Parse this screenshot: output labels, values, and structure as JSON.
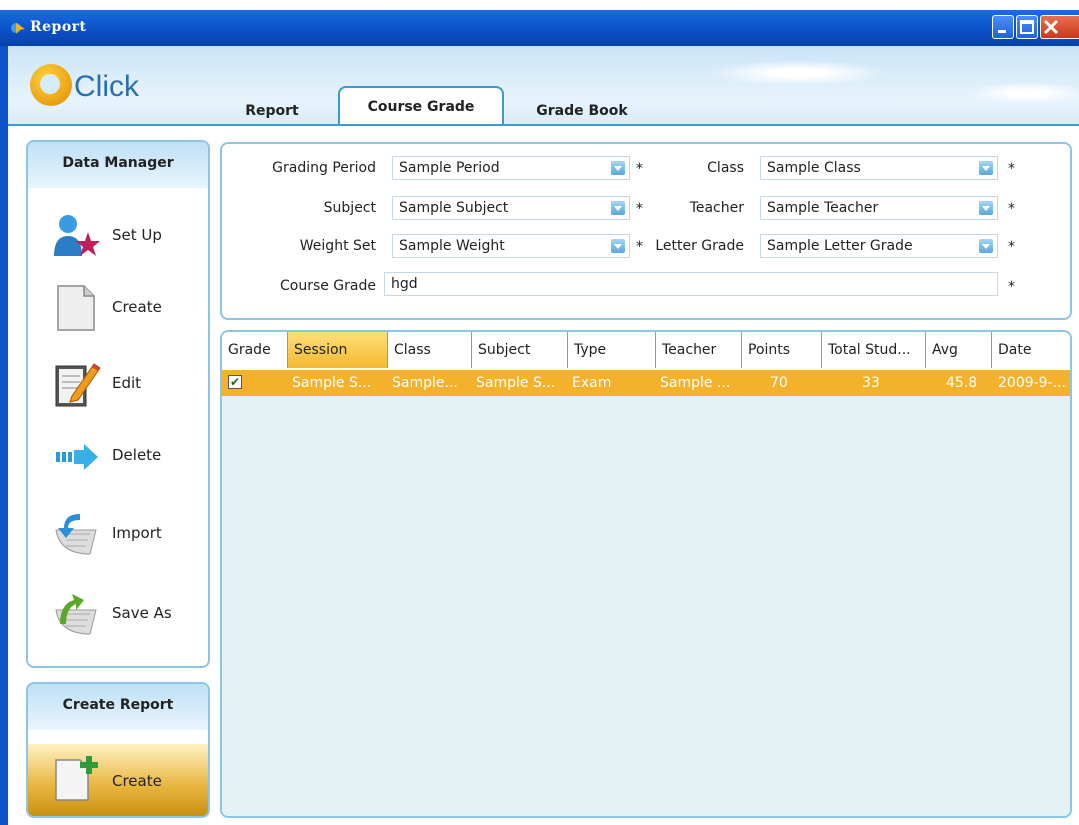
{
  "window": {
    "title": "Report"
  },
  "logo": {
    "text": "Click"
  },
  "tabs": [
    {
      "label": "Report"
    },
    {
      "label": "Course Grade",
      "active": true
    },
    {
      "label": "Grade Book"
    }
  ],
  "sidebar": {
    "title": "Data Manager",
    "items": [
      {
        "label": "Set Up",
        "icon": "user-star-icon"
      },
      {
        "label": "Create",
        "icon": "blank-document-icon"
      },
      {
        "label": "Edit",
        "icon": "notepad-pencil-icon"
      },
      {
        "label": "Delete",
        "icon": "arrow-right-icon"
      },
      {
        "label": "Import",
        "icon": "import-arrow-icon"
      },
      {
        "label": "Save As",
        "icon": "save-as-arrow-icon"
      }
    ]
  },
  "report_panel": {
    "title": "Create Report",
    "create_label": "Create",
    "create_icon": "document-plus-icon"
  },
  "form": {
    "grading_period": {
      "label": "Grading Period",
      "value": "Sample Period"
    },
    "class": {
      "label": "Class",
      "value": "Sample Class"
    },
    "subject": {
      "label": "Subject",
      "value": "Sample Subject"
    },
    "teacher": {
      "label": "Teacher",
      "value": "Sample Teacher"
    },
    "weight_set": {
      "label": "Weight Set",
      "value": "Sample Weight"
    },
    "letter_grade": {
      "label": "Letter Grade",
      "value": "Sample Letter Grade"
    },
    "course_grade": {
      "label": "Course Grade",
      "value": "hgd"
    },
    "required_mark": "*"
  },
  "grid": {
    "columns": [
      "Grade",
      "Session",
      "Class",
      "Subject",
      "Type",
      "Teacher",
      "Points",
      "Total Stud...",
      "Avg",
      "Date"
    ],
    "rows": [
      {
        "checked": true,
        "session": "Sample S...",
        "class": "Sample...",
        "subject": "Sample S...",
        "type": "Exam",
        "teacher": "Sample ...",
        "points": "70",
        "total": "33",
        "avg": "45.8",
        "date": "2009-9-..."
      }
    ]
  },
  "colors": {
    "accent": "#3a9cc8",
    "highlight": "#f4b12c",
    "titlebar": "#0a4fc6"
  }
}
